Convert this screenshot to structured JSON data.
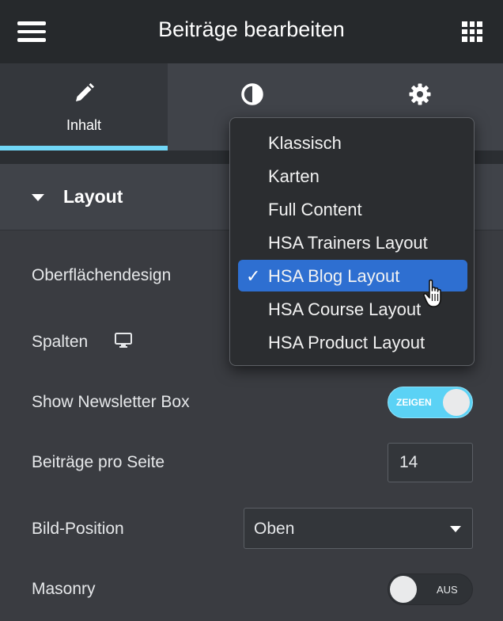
{
  "header": {
    "title": "Beiträge bearbeiten",
    "menu_icon": "hamburger-menu-icon",
    "apps_icon": "grid-apps-icon"
  },
  "tabs": [
    {
      "label": "Inhalt",
      "icon": "pencil-icon",
      "active": true
    },
    {
      "label": "",
      "icon": "contrast-icon",
      "active": false
    },
    {
      "label": "",
      "icon": "gear-icon",
      "active": false
    }
  ],
  "section": {
    "title": "Layout",
    "icon": "caret-down-icon"
  },
  "fields": {
    "skin_label": "Oberflächendesign",
    "columns_label": "Spalten",
    "columns_icon": "desktop-monitor-icon",
    "newsletter_label": "Show Newsletter Box",
    "newsletter_toggle": "ZEIGEN",
    "posts_per_page_label": "Beiträge pro Seite",
    "posts_per_page_value": "14",
    "image_position_label": "Bild-Position",
    "image_position_value": "Oben",
    "masonry_label": "Masonry",
    "masonry_toggle": "AUS"
  },
  "dropdown": {
    "options": [
      "Klassisch",
      "Karten",
      "Full Content",
      "HSA Trainers Layout",
      "HSA Blog Layout",
      "HSA Course Layout",
      "HSA Product Layout"
    ],
    "selected": "HSA Blog Layout",
    "check_mark": "✓"
  },
  "colors": {
    "accent": "#71d7f7",
    "toggle_on": "#5bd2f5",
    "selection": "#2e6fd1",
    "panel": "#3a3c41",
    "header": "#26292c"
  }
}
